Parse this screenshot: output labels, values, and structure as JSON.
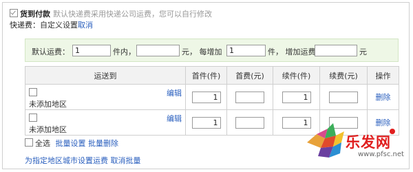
{
  "cod": {
    "checked": true,
    "label": "货到付款",
    "hint": "默认快递费采用快递公司运费，您可以自行修改"
  },
  "fee": {
    "label": "快递费：",
    "custom_text": "自定义设置",
    "cancel_link": "取消"
  },
  "default_fee": {
    "label": "默认运费：",
    "first_qty": "1",
    "unit_within": "件内，",
    "first_fee": "",
    "unit_yuan_each": "元，  每增加",
    "add_qty": "1",
    "unit_piece_add": "件，  增加运费",
    "add_fee": "",
    "unit_yuan": "元"
  },
  "table": {
    "headers": [
      "运送到",
      "首件(件)",
      "首费(元)",
      "续件(件)",
      "续费(元)",
      "操作"
    ],
    "rows": [
      {
        "edit": "编辑",
        "region": "未添加地区",
        "first_qty": "1",
        "first_fee": "",
        "add_qty": "1",
        "add_fee": "",
        "op": "删除"
      },
      {
        "edit": "编辑",
        "region": "未添加地区",
        "first_qty": "1",
        "first_fee": "",
        "add_qty": "1",
        "add_fee": "",
        "op": "删除"
      }
    ]
  },
  "bulk": {
    "select_all": "全选",
    "batch_set": "批量设置",
    "batch_delete": "批量删除"
  },
  "city": {
    "set_link": "为指定地区城市设置运费",
    "cancel_batch": "取消批量"
  },
  "watermark": {
    "text": "乐发网",
    "url": "www.pfsc.net"
  },
  "colors": {
    "link": "#2a5fbe",
    "default_box_bg": "#eef7e6",
    "header_bg": "#f2f2f2",
    "watermark_red": "#e01f1f"
  },
  "icons": [
    "checkbox-icon",
    "watermark-logo"
  ]
}
